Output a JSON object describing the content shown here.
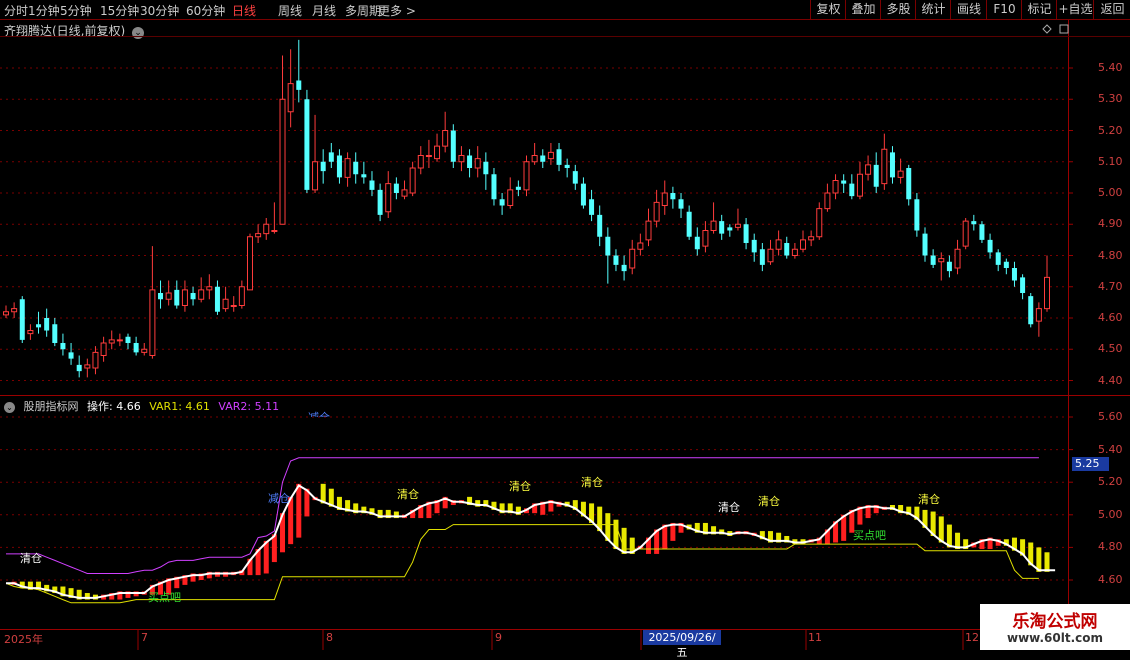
{
  "toolbar": {
    "periods": [
      "分时",
      "1分钟",
      "5分钟",
      "15分钟",
      "30分钟",
      "60分钟",
      "日线",
      "周线",
      "月线",
      "多周期",
      "更多 >"
    ],
    "active_period": "日线",
    "right_buttons": [
      "复权",
      "叠加",
      "多股",
      "统计",
      "画线",
      "F10",
      "标记",
      "+自选",
      "返回"
    ]
  },
  "chart_title": "齐翔腾达(日线,前复权)",
  "indicator": {
    "name": "股朋指标网",
    "op_label": "操作: 4.66",
    "var1_label": "VAR1: 4.61",
    "var2_label": "VAR2: 5.11"
  },
  "colors": {
    "up": "#ff3c3c",
    "down": "#54ffff",
    "var1": "#e0e000",
    "var2": "#d040ff",
    "op": "#ffffff",
    "buy": "#ff2020",
    "sell": "#e8e800",
    "grid": "#7a0000"
  },
  "price_axis": [
    "5.40",
    "5.30",
    "5.20",
    "5.10",
    "5.00",
    "4.90",
    "4.80",
    "4.70",
    "4.60",
    "4.50",
    "4.40"
  ],
  "ind_axis": [
    "5.60",
    "5.40",
    "5.20",
    "5.00",
    "4.80",
    "4.60"
  ],
  "current_value": "5.25",
  "dates": [
    "2025年",
    "7",
    "8",
    "9",
    "2025/09/26/五",
    "11",
    "12"
  ],
  "signals": {
    "clear": "清仓",
    "reduce": "减仓",
    "buy": "买点吧",
    "reduce_top": "减仓"
  },
  "watermark": {
    "line1": "乐淘公式网",
    "line2": "www.60lt.com"
  },
  "chart_data": {
    "type": "candlestick",
    "title": "齐翔腾达(日线,前复权)",
    "ylim": [
      4.38,
      5.5
    ],
    "candles": [
      [
        4.61,
        4.62,
        4.64,
        4.6
      ],
      [
        4.62,
        4.63,
        4.65,
        4.6
      ],
      [
        4.66,
        4.53,
        4.67,
        4.52
      ],
      [
        4.55,
        4.56,
        4.58,
        4.53
      ],
      [
        4.58,
        4.57,
        4.62,
        4.55
      ],
      [
        4.6,
        4.56,
        4.63,
        4.54
      ],
      [
        4.58,
        4.52,
        4.6,
        4.51
      ],
      [
        4.52,
        4.5,
        4.55,
        4.48
      ],
      [
        4.49,
        4.47,
        4.52,
        4.45
      ],
      [
        4.45,
        4.43,
        4.48,
        4.41
      ],
      [
        4.44,
        4.45,
        4.47,
        4.41
      ],
      [
        4.44,
        4.49,
        4.51,
        4.42
      ],
      [
        4.48,
        4.52,
        4.54,
        4.46
      ],
      [
        4.52,
        4.53,
        4.56,
        4.5
      ],
      [
        4.53,
        4.53,
        4.55,
        4.51
      ],
      [
        4.54,
        4.52,
        4.55,
        4.5
      ],
      [
        4.52,
        4.49,
        4.54,
        4.48
      ],
      [
        4.49,
        4.5,
        4.52,
        4.48
      ],
      [
        4.48,
        4.69,
        4.83,
        4.47
      ],
      [
        4.68,
        4.66,
        4.72,
        4.63
      ],
      [
        4.66,
        4.68,
        4.72,
        4.64
      ],
      [
        4.69,
        4.64,
        4.72,
        4.63
      ],
      [
        4.64,
        4.69,
        4.72,
        4.62
      ],
      [
        4.68,
        4.66,
        4.7,
        4.64
      ],
      [
        4.66,
        4.69,
        4.73,
        4.65
      ],
      [
        4.69,
        4.7,
        4.74,
        4.66
      ],
      [
        4.7,
        4.62,
        4.72,
        4.61
      ],
      [
        4.63,
        4.66,
        4.7,
        4.62
      ],
      [
        4.64,
        4.64,
        4.67,
        4.62
      ],
      [
        4.64,
        4.7,
        4.72,
        4.63
      ],
      [
        4.69,
        4.86,
        4.87,
        4.69
      ],
      [
        4.86,
        4.87,
        4.9,
        4.84
      ],
      [
        4.87,
        4.9,
        4.92,
        4.85
      ],
      [
        4.88,
        4.88,
        4.97,
        4.87
      ],
      [
        4.9,
        5.3,
        5.44,
        4.9
      ],
      [
        5.26,
        5.35,
        5.46,
        5.21
      ],
      [
        5.36,
        5.33,
        5.49,
        5.29
      ],
      [
        5.3,
        5.01,
        5.33,
        5.0
      ],
      [
        5.01,
        5.1,
        5.25,
        5.0
      ],
      [
        5.1,
        5.07,
        5.14,
        5.03
      ],
      [
        5.13,
        5.1,
        5.16,
        5.08
      ],
      [
        5.12,
        5.05,
        5.14,
        5.03
      ],
      [
        5.05,
        5.11,
        5.13,
        5.02
      ],
      [
        5.1,
        5.06,
        5.13,
        5.03
      ],
      [
        5.06,
        5.05,
        5.1,
        5.03
      ],
      [
        5.04,
        5.01,
        5.07,
        4.99
      ],
      [
        5.01,
        4.93,
        5.03,
        4.91
      ],
      [
        4.94,
        5.03,
        5.07,
        4.92
      ],
      [
        5.03,
        5.0,
        5.05,
        4.98
      ],
      [
        4.99,
        5.01,
        5.04,
        4.98
      ],
      [
        5.0,
        5.08,
        5.1,
        4.99
      ],
      [
        5.08,
        5.12,
        5.15,
        5.06
      ],
      [
        5.12,
        5.12,
        5.17,
        5.08
      ],
      [
        5.11,
        5.15,
        5.19,
        5.1
      ],
      [
        5.15,
        5.2,
        5.26,
        5.13
      ],
      [
        5.2,
        5.1,
        5.22,
        5.08
      ],
      [
        5.1,
        5.12,
        5.15,
        5.07
      ],
      [
        5.12,
        5.08,
        5.14,
        5.05
      ],
      [
        5.08,
        5.11,
        5.15,
        5.05
      ],
      [
        5.1,
        5.06,
        5.13,
        5.01
      ],
      [
        5.06,
        4.98,
        5.08,
        4.96
      ],
      [
        4.98,
        4.96,
        5.0,
        4.93
      ],
      [
        4.96,
        5.01,
        5.05,
        4.95
      ],
      [
        5.02,
        5.01,
        5.04,
        4.99
      ],
      [
        5.01,
        5.1,
        5.12,
        4.99
      ],
      [
        5.1,
        5.12,
        5.16,
        5.09
      ],
      [
        5.12,
        5.1,
        5.14,
        5.08
      ],
      [
        5.11,
        5.13,
        5.16,
        5.09
      ],
      [
        5.14,
        5.09,
        5.16,
        5.07
      ],
      [
        5.09,
        5.08,
        5.11,
        5.05
      ],
      [
        5.07,
        5.03,
        5.09,
        5.01
      ],
      [
        5.03,
        4.96,
        5.05,
        4.95
      ],
      [
        4.98,
        4.93,
        5.01,
        4.91
      ],
      [
        4.93,
        4.86,
        4.96,
        4.83
      ],
      [
        4.86,
        4.8,
        4.89,
        4.71
      ],
      [
        4.8,
        4.77,
        4.82,
        4.75
      ],
      [
        4.77,
        4.75,
        4.8,
        4.72
      ],
      [
        4.76,
        4.82,
        4.85,
        4.74
      ],
      [
        4.82,
        4.84,
        4.87,
        4.8
      ],
      [
        4.85,
        4.91,
        4.95,
        4.83
      ],
      [
        4.91,
        4.97,
        5.01,
        4.89
      ],
      [
        4.96,
        5.0,
        5.04,
        4.93
      ],
      [
        5.0,
        4.98,
        5.02,
        4.95
      ],
      [
        4.98,
        4.95,
        5.0,
        4.92
      ],
      [
        4.94,
        4.86,
        4.96,
        4.85
      ],
      [
        4.86,
        4.82,
        4.89,
        4.8
      ],
      [
        4.83,
        4.88,
        4.91,
        4.81
      ],
      [
        4.88,
        4.91,
        4.97,
        4.87
      ],
      [
        4.91,
        4.87,
        4.93,
        4.85
      ],
      [
        4.89,
        4.88,
        4.9,
        4.86
      ],
      [
        4.89,
        4.9,
        4.95,
        4.88
      ],
      [
        4.9,
        4.84,
        4.92,
        4.82
      ],
      [
        4.85,
        4.81,
        4.87,
        4.78
      ],
      [
        4.82,
        4.77,
        4.84,
        4.75
      ],
      [
        4.78,
        4.82,
        4.85,
        4.77
      ],
      [
        4.82,
        4.85,
        4.88,
        4.8
      ],
      [
        4.84,
        4.8,
        4.86,
        4.79
      ],
      [
        4.8,
        4.82,
        4.84,
        4.79
      ],
      [
        4.82,
        4.85,
        4.88,
        4.81
      ],
      [
        4.85,
        4.86,
        4.88,
        4.83
      ],
      [
        4.86,
        4.95,
        4.97,
        4.85
      ],
      [
        4.95,
        5.0,
        5.03,
        4.94
      ],
      [
        5.0,
        5.04,
        5.06,
        4.98
      ],
      [
        5.04,
        5.03,
        5.06,
        5.0
      ],
      [
        5.03,
        4.99,
        5.06,
        4.98
      ],
      [
        4.99,
        5.06,
        5.1,
        4.98
      ],
      [
        5.06,
        5.09,
        5.12,
        5.04
      ],
      [
        5.09,
        5.02,
        5.13,
        5.0
      ],
      [
        5.03,
        5.14,
        5.19,
        5.01
      ],
      [
        5.13,
        5.05,
        5.15,
        5.03
      ],
      [
        5.05,
        5.07,
        5.11,
        5.03
      ],
      [
        5.08,
        4.98,
        5.09,
        4.96
      ],
      [
        4.98,
        4.88,
        5.0,
        4.86
      ],
      [
        4.87,
        4.8,
        4.89,
        4.78
      ],
      [
        4.8,
        4.77,
        4.82,
        4.76
      ],
      [
        4.78,
        4.79,
        4.81,
        4.72
      ],
      [
        4.78,
        4.75,
        4.8,
        4.73
      ],
      [
        4.76,
        4.82,
        4.85,
        4.74
      ],
      [
        4.83,
        4.91,
        4.92,
        4.82
      ],
      [
        4.91,
        4.9,
        4.93,
        4.88
      ],
      [
        4.9,
        4.85,
        4.91,
        4.84
      ],
      [
        4.85,
        4.81,
        4.87,
        4.79
      ],
      [
        4.81,
        4.77,
        4.82,
        4.75
      ],
      [
        4.78,
        4.76,
        4.79,
        4.74
      ],
      [
        4.76,
        4.72,
        4.78,
        4.7
      ],
      [
        4.73,
        4.68,
        4.74,
        4.66
      ],
      [
        4.67,
        4.58,
        4.68,
        4.57
      ],
      [
        4.59,
        4.63,
        4.65,
        4.54
      ],
      [
        4.63,
        4.73,
        4.8,
        4.62
      ]
    ],
    "op_series": [
      4.58,
      4.58,
      4.56,
      4.55,
      4.55,
      4.54,
      4.53,
      4.51,
      4.5,
      4.49,
      4.49,
      4.49,
      4.5,
      4.51,
      4.52,
      4.52,
      4.52,
      4.52,
      4.56,
      4.58,
      4.6,
      4.61,
      4.62,
      4.63,
      4.63,
      4.64,
      4.64,
      4.64,
      4.64,
      4.65,
      4.72,
      4.78,
      4.83,
      4.87,
      5.0,
      5.1,
      5.18,
      5.15,
      5.1,
      5.08,
      5.06,
      5.04,
      5.03,
      5.02,
      5.02,
      5.01,
      4.99,
      4.99,
      4.99,
      4.99,
      5.02,
      5.05,
      5.07,
      5.08,
      5.1,
      5.08,
      5.08,
      5.07,
      5.06,
      5.06,
      5.04,
      5.02,
      5.02,
      5.01,
      5.03,
      5.06,
      5.07,
      5.08,
      5.07,
      5.06,
      5.04,
      5.0,
      4.96,
      4.91,
      4.85,
      4.8,
      4.77,
      4.77,
      4.8,
      4.85,
      4.9,
      4.93,
      4.94,
      4.94,
      4.92,
      4.9,
      4.89,
      4.89,
      4.89,
      4.88,
      4.89,
      4.89,
      4.88,
      4.86,
      4.84,
      4.84,
      4.84,
      4.83,
      4.83,
      4.84,
      4.85,
      4.9,
      4.95,
      4.99,
      5.02,
      5.04,
      5.05,
      5.05,
      5.04,
      5.04,
      5.02,
      5.01,
      4.98,
      4.93,
      4.88,
      4.84,
      4.81,
      4.8,
      4.8,
      4.82,
      4.84,
      4.85,
      4.84,
      4.82,
      4.79,
      4.76,
      4.7,
      4.66,
      4.66,
      4.66
    ],
    "var1_series": [
      4.58,
      4.56,
      4.55,
      4.55,
      4.54,
      4.52,
      4.5,
      4.48,
      4.46,
      4.46,
      4.46,
      4.46,
      4.46,
      4.46,
      4.46,
      4.47,
      4.48,
      4.48,
      4.48,
      4.48,
      4.48,
      4.48,
      4.48,
      4.48,
      4.48,
      4.48,
      4.48,
      4.48,
      4.48,
      4.48,
      4.48,
      4.48,
      4.48,
      4.48,
      4.62,
      4.62,
      4.62,
      4.62,
      4.62,
      4.62,
      4.62,
      4.62,
      4.62,
      4.62,
      4.62,
      4.62,
      4.62,
      4.62,
      4.62,
      4.62,
      4.71,
      4.85,
      4.91,
      4.91,
      4.91,
      4.94,
      4.94,
      4.94,
      4.94,
      4.94,
      4.94,
      4.94,
      4.94,
      4.94,
      4.94,
      4.94,
      4.94,
      4.94,
      4.94,
      4.94,
      4.94,
      4.94,
      4.94,
      4.94,
      4.94,
      4.94,
      4.79,
      4.79,
      4.79,
      4.79,
      4.79,
      4.79,
      4.79,
      4.79,
      4.79,
      4.79,
      4.79,
      4.79,
      4.79,
      4.79,
      4.79,
      4.79,
      4.79,
      4.79,
      4.79,
      4.79,
      4.79,
      4.82,
      4.82,
      4.82,
      4.82,
      4.82,
      4.82,
      4.82,
      4.82,
      4.82,
      4.82,
      4.82,
      4.82,
      4.82,
      4.82,
      4.82,
      4.82,
      4.78,
      4.78,
      4.78,
      4.78,
      4.78,
      4.78,
      4.78,
      4.78,
      4.78,
      4.78,
      4.78,
      4.66,
      4.61,
      4.61,
      4.61
    ],
    "var2_series": [
      4.76,
      4.76,
      4.76,
      4.76,
      4.76,
      4.74,
      4.72,
      4.7,
      4.68,
      4.66,
      4.64,
      4.64,
      4.64,
      4.64,
      4.64,
      4.64,
      4.65,
      4.66,
      4.66,
      4.68,
      4.71,
      4.72,
      4.72,
      4.72,
      4.73,
      4.74,
      4.74,
      4.74,
      4.74,
      4.74,
      4.76,
      4.86,
      4.87,
      4.9,
      5.2,
      5.33,
      5.35,
      5.35,
      5.35,
      5.35,
      5.35,
      5.35,
      5.35,
      5.35,
      5.35,
      5.35,
      5.35,
      5.35,
      5.35,
      5.35,
      5.35,
      5.35,
      5.35,
      5.35,
      5.35,
      5.35,
      5.35,
      5.35,
      5.35,
      5.35,
      5.35,
      5.35,
      5.35,
      5.35,
      5.35,
      5.35,
      5.35,
      5.35,
      5.35,
      5.35,
      5.35,
      5.35,
      5.35,
      5.35,
      5.35,
      5.35,
      5.35,
      5.35,
      5.35,
      5.35,
      5.35,
      5.35,
      5.35,
      5.35,
      5.35,
      5.35,
      5.35,
      5.35,
      5.35,
      5.35,
      5.35,
      5.35,
      5.35,
      5.35,
      5.35,
      5.35,
      5.35,
      5.35,
      5.35,
      5.35,
      5.35,
      5.35,
      5.35,
      5.35,
      5.35,
      5.35,
      5.35,
      5.35,
      5.35,
      5.35,
      5.35,
      5.35,
      5.35,
      5.35,
      5.35,
      5.35,
      5.35,
      5.35,
      5.35,
      5.35,
      5.35,
      5.35,
      5.35,
      5.35,
      5.35,
      5.35,
      5.35,
      5.35
    ]
  }
}
